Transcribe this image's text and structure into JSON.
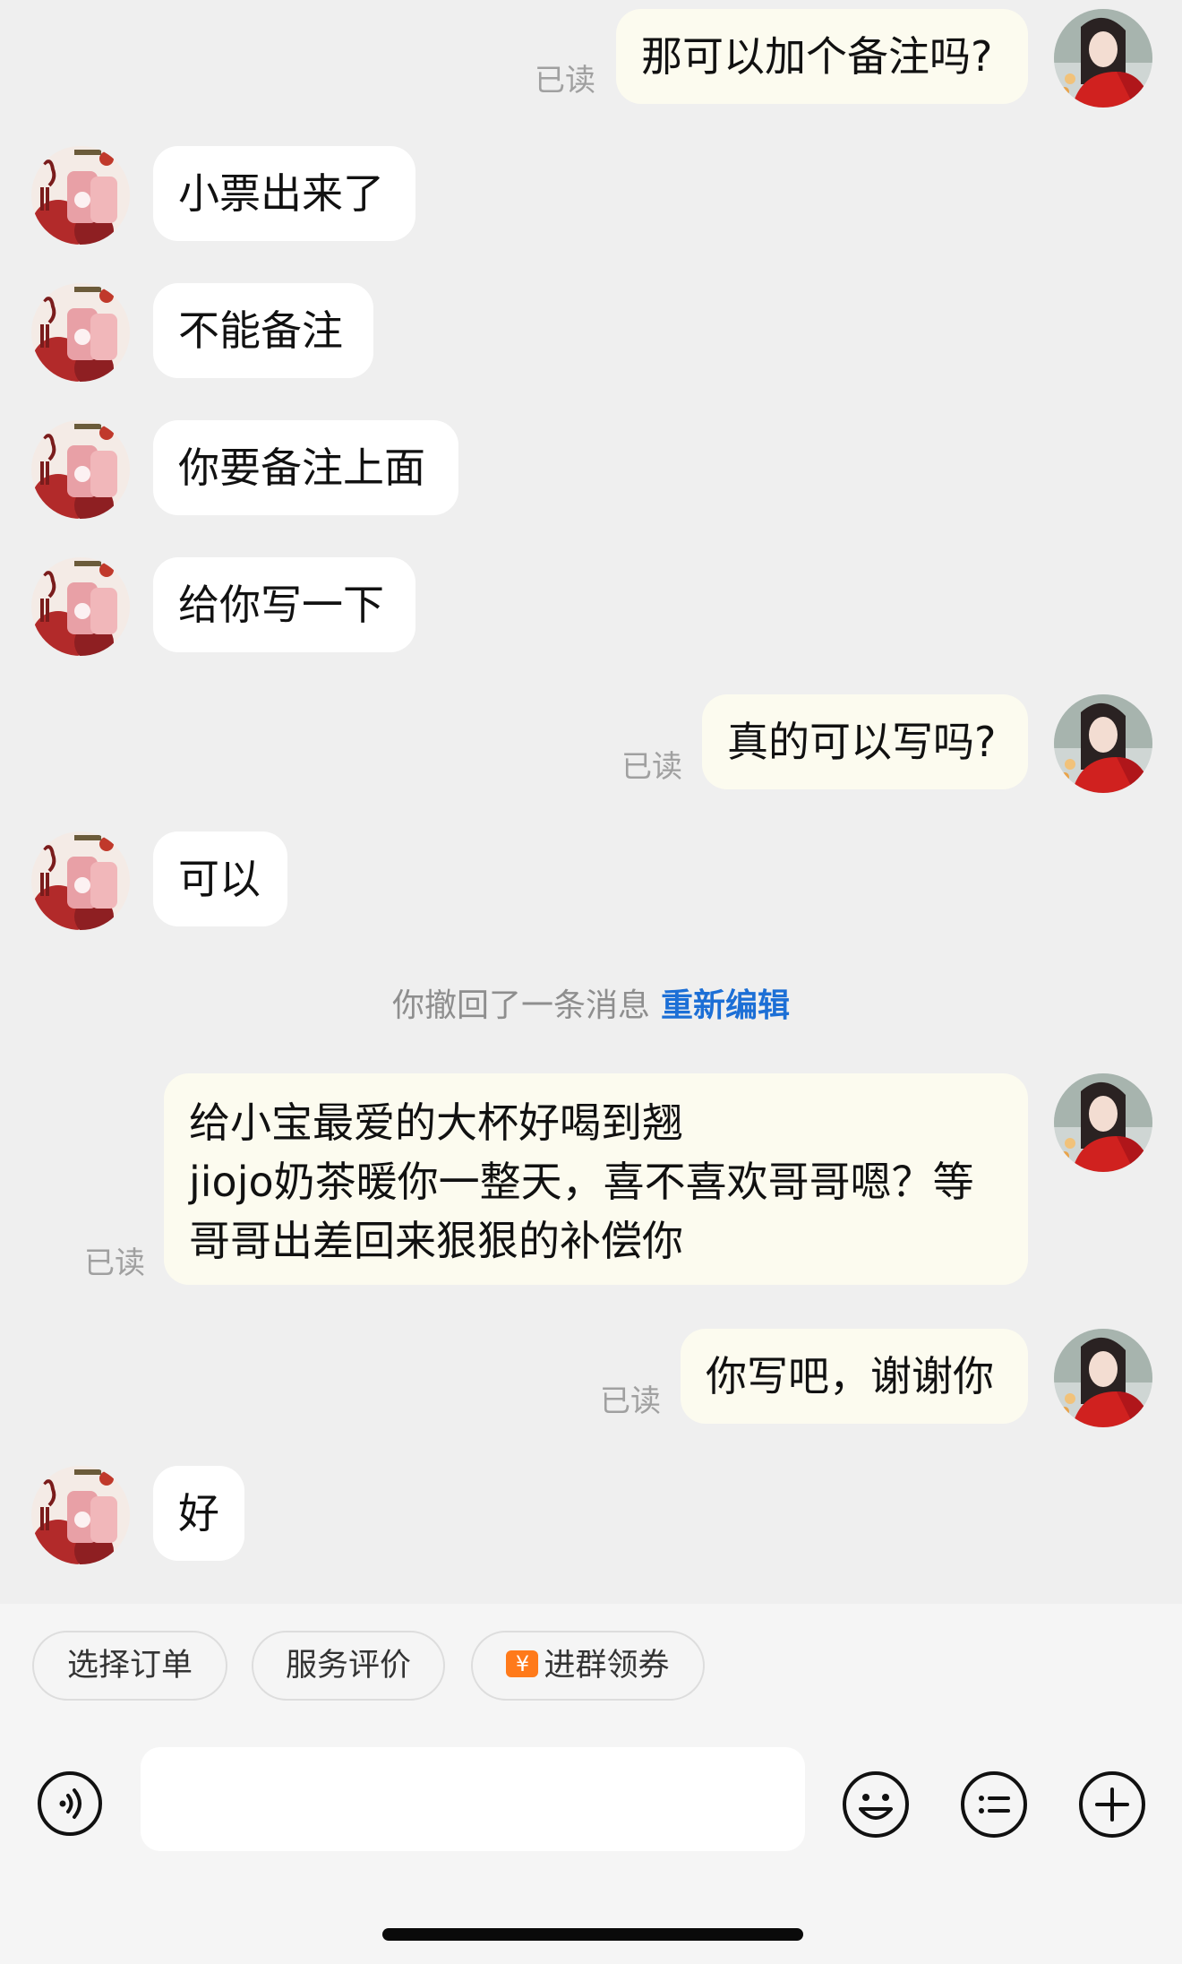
{
  "messages": [
    {
      "side": "out",
      "text": "那可以加个备注吗?",
      "read": "已读"
    },
    {
      "side": "in",
      "text": "小票出来了"
    },
    {
      "side": "in",
      "text": "不能备注"
    },
    {
      "side": "in",
      "text": "你要备注上面"
    },
    {
      "side": "in",
      "text": "给你写一下"
    },
    {
      "side": "out",
      "text": "真的可以写吗?",
      "read": "已读"
    },
    {
      "side": "in",
      "text": "可以"
    },
    {
      "side": "out",
      "lines": [
        "给小宝最爱的大杯好喝到翘",
        "jiojo奶茶暖你一整天，喜不喜欢哥哥嗯？等",
        "哥哥出差回来狠狠的补偿你"
      ],
      "read": "已读"
    },
    {
      "side": "out",
      "text": "你写吧，谢谢你",
      "read": "已读"
    },
    {
      "side": "in",
      "text": "好"
    }
  ],
  "system_notice": {
    "text": "你撤回了一条消息",
    "action": "重新编辑"
  },
  "quick_actions": [
    {
      "label": "选择订单"
    },
    {
      "label": "服务评价"
    },
    {
      "label": "进群领券",
      "badge": "¥"
    }
  ],
  "input": {
    "placeholder": ""
  },
  "icons": {
    "voice": "voice-icon",
    "emoji": "emoji-icon",
    "more": "list-icon",
    "add": "plus-icon"
  },
  "colors": {
    "background": "#efefef",
    "incoming_bubble": "#ffffff",
    "outgoing_bubble": "#fcfbef",
    "link": "#1c6fd6",
    "coupon": "#ff7a1a"
  }
}
